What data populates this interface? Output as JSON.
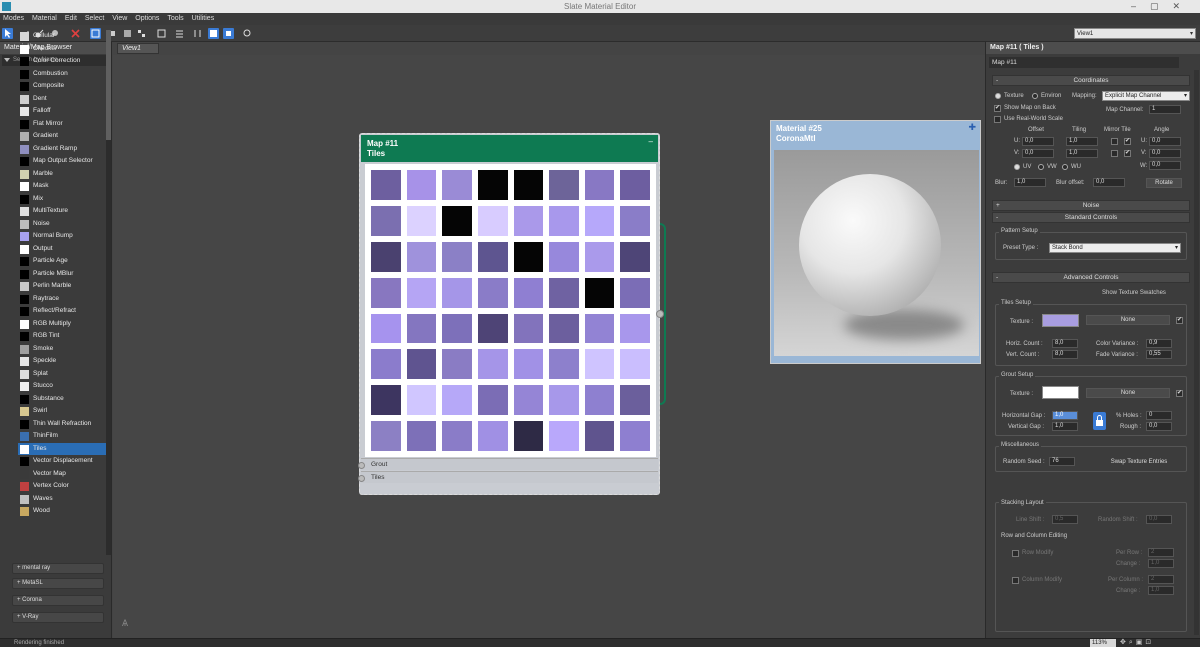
{
  "window": {
    "title": "Slate Material Editor"
  },
  "menu": [
    "Modes",
    "Material",
    "Edit",
    "Select",
    "View",
    "Options",
    "Tools",
    "Utilities"
  ],
  "toolbar": {
    "view_select": "View1"
  },
  "browser": {
    "title": "Material/Map Browser",
    "search_placeholder": "Search by Name ...",
    "items": [
      {
        "label": "Cellular",
        "color": "#d8d8d8"
      },
      {
        "label": "Checker",
        "color": "#ffffff"
      },
      {
        "label": "Color Correction",
        "color": "#000000"
      },
      {
        "label": "Combustion",
        "color": "#000000"
      },
      {
        "label": "Composite",
        "color": "#000000"
      },
      {
        "label": "Dent",
        "color": "#cfcfcf"
      },
      {
        "label": "Falloff",
        "color": "#e8e8e8"
      },
      {
        "label": "Flat Mirror",
        "color": "#000000"
      },
      {
        "label": "Gradient",
        "color": "#b0b0b0"
      },
      {
        "label": "Gradient Ramp",
        "color": "#9090c0"
      },
      {
        "label": "Map Output Selector",
        "color": "#000000"
      },
      {
        "label": "Marble",
        "color": "#d0d0b0"
      },
      {
        "label": "Mask",
        "color": "#ffffff"
      },
      {
        "label": "Mix",
        "color": "#000000"
      },
      {
        "label": "MultiTexture",
        "color": "#e0e0e0"
      },
      {
        "label": "Noise",
        "color": "#bdbdbd"
      },
      {
        "label": "Normal Bump",
        "color": "#a7a0ee"
      },
      {
        "label": "Output",
        "color": "#ffffff"
      },
      {
        "label": "Particle Age",
        "color": "#000000"
      },
      {
        "label": "Particle MBlur",
        "color": "#000000"
      },
      {
        "label": "Perlin Marble",
        "color": "#c9c9c9"
      },
      {
        "label": "Raytrace",
        "color": "#000000"
      },
      {
        "label": "Reflect/Refract",
        "color": "#000000"
      },
      {
        "label": "RGB Multiply",
        "color": "#ffffff"
      },
      {
        "label": "RGB Tint",
        "color": "#000000"
      },
      {
        "label": "Smoke",
        "color": "#a0a0a0"
      },
      {
        "label": "Speckle",
        "color": "#e6e6e6"
      },
      {
        "label": "Splat",
        "color": "#dcdcdc"
      },
      {
        "label": "Stucco",
        "color": "#f0f0f0"
      },
      {
        "label": "Substance",
        "color": "#000000"
      },
      {
        "label": "Swirl",
        "color": "#d8c890"
      },
      {
        "label": "Thin Wall Refraction",
        "color": "#000000"
      },
      {
        "label": "ThinFilm",
        "color": "#3a6fb0"
      },
      {
        "label": "Tiles",
        "color": "#ffffff",
        "selected": true
      },
      {
        "label": "Vector Displacement",
        "color": "#000000"
      },
      {
        "label": "Vector Map",
        "color": "#3a3a3a"
      },
      {
        "label": "Vertex Color",
        "color": "#c04040"
      },
      {
        "label": "Waves",
        "color": "#c0c0c0"
      },
      {
        "label": "Wood",
        "color": "#c8a860"
      }
    ],
    "rollouts": [
      "+ mental ray",
      "+ MetaSL",
      "+ Corona",
      "+ V-Ray"
    ]
  },
  "view_tab": "View1",
  "map_node": {
    "title": "Map #11",
    "subtitle": "Tiles",
    "slots": [
      "Grout",
      "Tiles"
    ],
    "grid": [
      [
        "#6d5f9f",
        "#a792e8",
        "#9a8bd6",
        "#050505",
        "#050505",
        "#6d6499",
        "#8878c4",
        "#6d5ea0"
      ],
      [
        "#7b6fb0",
        "#dcd2ff",
        "#050505",
        "#d8ccff",
        "#aa99ea",
        "#a898ec",
        "#b6a8fa",
        "#8a7dc8"
      ],
      [
        "#4a416f",
        "#9f92dc",
        "#8b80c6",
        "#5e5590",
        "#050505",
        "#9788dc",
        "#aa9aeb",
        "#4e4577"
      ],
      [
        "#8877c0",
        "#b5a5f4",
        "#a596e8",
        "#8a7cc8",
        "#8f7fd2",
        "#6f62a2",
        "#050505",
        "#7b6db6"
      ],
      [
        "#a693ee",
        "#8476c0",
        "#7d70ba",
        "#4e4476",
        "#8273bc",
        "#6c5f9e",
        "#9283d4",
        "#a897ec"
      ],
      [
        "#8b7ccc",
        "#5f5490",
        "#8a7cc4",
        "#a595e8",
        "#a191e6",
        "#8d80cc",
        "#cfc4ff",
        "#cabefe"
      ],
      [
        "#3d3560",
        "#d0c6ff",
        "#b6a8f8",
        "#7b6db5",
        "#9585d6",
        "#a798ea",
        "#8e80d0",
        "#6b5f9c"
      ],
      [
        "#8c80c4",
        "#7d70b8",
        "#8a7cc8",
        "#a090e4",
        "#2e2a45",
        "#b9a8fb",
        "#5f548e",
        "#8e7fd0"
      ]
    ]
  },
  "material_node": {
    "title": "Material #25",
    "subtitle": "CoronaMtl"
  },
  "props": {
    "header": "Map #11 ( Tiles )",
    "name": "Map #11",
    "coordinates": {
      "title": "Coordinates",
      "texture": "Texture",
      "environ": "Environ",
      "mapping_label": "Mapping:",
      "mapping_value": "Explicit Map Channel",
      "show_map": "Show Map on Back",
      "map_channel_label": "Map Channel:",
      "map_channel_value": "1",
      "real_world": "Use Real-World Scale",
      "col_offset": "Offset",
      "col_tiling": "Tiling",
      "col_mirror": "Mirror Tile",
      "col_angle": "Angle",
      "u": "U:",
      "v": "V:",
      "w": "W:",
      "u_offset": "0,0",
      "v_offset": "0,0",
      "u_tiling": "1,0",
      "v_tiling": "1,0",
      "u_angle": "0,0",
      "v_angle": "0,0",
      "w_angle": "0,0",
      "uv": "UV",
      "vw": "VW",
      "wu": "WU",
      "blur_label": "Blur:",
      "blur_value": "1,0",
      "blur_offset_label": "Blur offset:",
      "blur_offset_value": "0,0",
      "rotate": "Rotate"
    },
    "noise_title": "Noise",
    "standard": {
      "title": "Standard Controls",
      "pattern_setup": "Pattern Setup",
      "preset_label": "Preset Type :",
      "preset_value": "Stack Bond"
    },
    "advanced": {
      "title": "Advanced Controls",
      "show_swatches": "Show Texture Swatches",
      "tiles_setup": "Tiles Setup",
      "texture_label": "Texture :",
      "tile_texture_color": "#a89de0",
      "none": "None",
      "horiz_count_label": "Horiz. Count :",
      "horiz_count": "8,0",
      "vert_count_label": "Vert. Count :",
      "vert_count": "8,0",
      "color_variance_label": "Color Variance :",
      "color_variance": "0,9",
      "fade_variance_label": "Fade Variance :",
      "fade_variance": "0,55",
      "grout_setup": "Grout Setup",
      "grout_texture_color": "#ffffff",
      "hgap_label": "Horizontal Gap :",
      "hgap": "1,0",
      "vgap_label": "Vertical Gap :",
      "vgap": "1,0",
      "holes_label": "% Holes :",
      "holes": "0",
      "rough_label": "Rough :",
      "rough": "0,0",
      "misc": "Miscellaneous",
      "seed_label": "Random Seed :",
      "seed": "76",
      "swap": "Swap Texture Entries"
    },
    "stacking": {
      "title": "Stacking Layout",
      "line_shift_label": "Line Shift :",
      "line_shift": "0,5",
      "random_shift_label": "Random Shift :",
      "random_shift": "0,0",
      "row_col": "Row and Column Editing",
      "row_modify": "Row Modify",
      "per_row_label": "Per Row :",
      "per_row": "2",
      "change_label": "Change :",
      "change_row": "1,0",
      "col_modify": "Column Modify",
      "per_col_label": "Per Column :",
      "per_col": "2",
      "change_col": "1,0"
    }
  },
  "status": {
    "text": "Rendering finished",
    "zoom": "113%"
  }
}
